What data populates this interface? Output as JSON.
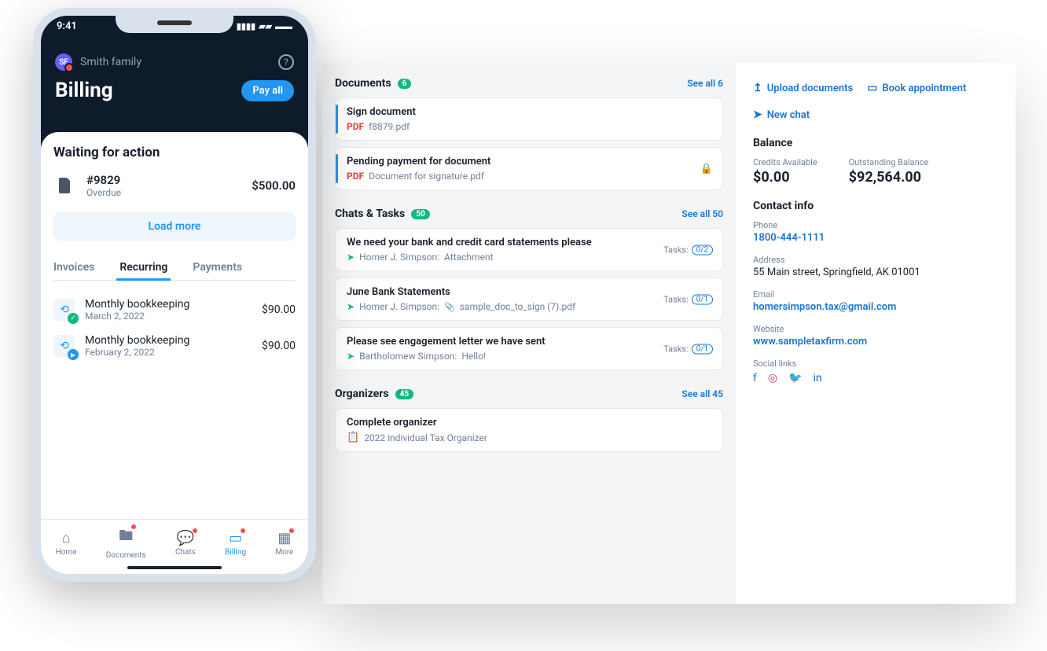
{
  "phone": {
    "status_time": "9:41",
    "avatar_initials": "SF",
    "family_name": "Smith family",
    "title": "Billing",
    "pay_all": "Pay all",
    "waiting_title": "Waiting for action",
    "invoice": {
      "num": "#9829",
      "status": "Overdue",
      "amount": "$500.00"
    },
    "load_more": "Load more",
    "tabs": {
      "invoices": "Invoices",
      "recurring": "Recurring",
      "payments": "Payments"
    },
    "recurring": [
      {
        "title": "Monthly bookkeeping",
        "date": "March 2, 2022",
        "amount": "$90.00",
        "status": "ok"
      },
      {
        "title": "Monthly bookkeeping",
        "date": "February 2, 2022",
        "amount": "$90.00",
        "status": "play"
      }
    ],
    "nav": {
      "home": "Home",
      "documents": "Documents",
      "chats": "Chats",
      "billing": "Billing",
      "more": "More"
    }
  },
  "mid": {
    "documents": {
      "title": "Documents",
      "count": "6",
      "see_all": "See all 6",
      "items": [
        {
          "title": "Sign document",
          "file": "f8879.pdf"
        },
        {
          "title": "Pending payment for document",
          "file": "Document for signature.pdf",
          "locked": true
        }
      ]
    },
    "chats": {
      "title": "Chats & Tasks",
      "count": "50",
      "see_all": "See all 50",
      "items": [
        {
          "title": "We need your bank and credit card statements please",
          "author": "Homer J. Simpson:",
          "attach": "Attachment",
          "tasks": "0/2"
        },
        {
          "title": "June Bank Statements",
          "author": "Homer J. Simpson:",
          "attach": "sample_doc_to_sign (7).pdf",
          "clip": true,
          "tasks": "0/1"
        },
        {
          "title": "Please see engagement letter we have sent",
          "author": "Bartholomew Simpson:",
          "attach": "Hello!",
          "tasks": "0/1"
        }
      ],
      "tasks_label": "Tasks:"
    },
    "organizers": {
      "title": "Organizers",
      "count": "45",
      "see_all": "See all 45",
      "items": [
        {
          "title": "Complete organizer",
          "file": "2022 individual Tax Organizer"
        }
      ]
    }
  },
  "right": {
    "actions": {
      "upload": "Upload documents",
      "book": "Book appointment",
      "chat": "New chat"
    },
    "balance_title": "Balance",
    "credits_label": "Credits Available",
    "credits_value": "$0.00",
    "outstanding_label": "Outstanding Balance",
    "outstanding_value": "$92,564.00",
    "contact_title": "Contact info",
    "phone_label": "Phone",
    "phone_value": "1800-444-1111",
    "address_label": "Address",
    "address_value": "55 Main street, Springfield, AK 01001",
    "email_label": "Email",
    "email_value": "homersimpson.tax@gmail.com",
    "website_label": "Website",
    "website_value": "www.sampletaxfirm.com",
    "social_label": "Social links"
  }
}
